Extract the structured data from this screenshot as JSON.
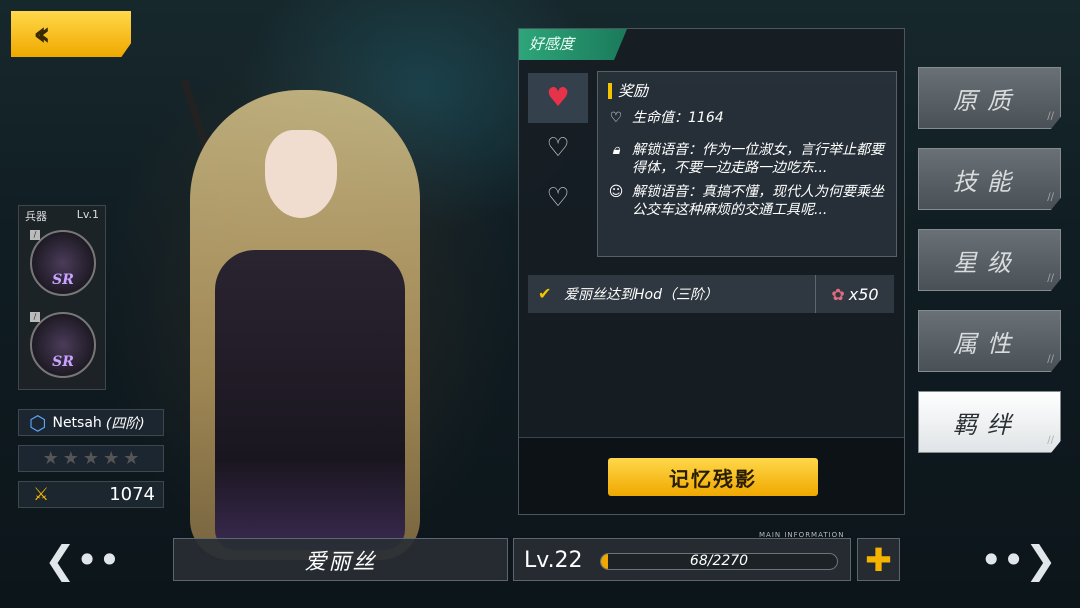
{
  "back": {
    "icon": "back-chevron-icon"
  },
  "weapon": {
    "label": "兵器",
    "level": "Lv.1",
    "slot1_rank": "SR",
    "slot2_rank": "SR"
  },
  "rank": {
    "name": "Netsah",
    "tier": "(四阶)"
  },
  "stars": {
    "filled": 0,
    "total": 5
  },
  "power": {
    "value": "1074"
  },
  "affection": {
    "tab_label": "好感度",
    "reward": {
      "title": "奖励",
      "hp_label": "生命值：1164",
      "voice1": "解锁语音：作为一位淑女，言行举止都要得体，不要一边走路一边吃东...",
      "voice2": "解锁语音：真搞不懂，现代人为何要乘坐公交车这种麻烦的交通工具呢..."
    },
    "task": {
      "text": "爱丽丝达到Hod（三阶）",
      "cost": "x50",
      "completed": true
    },
    "memory_button": "记忆残影"
  },
  "menu": [
    {
      "label": "原质",
      "active": false
    },
    {
      "label": "技能",
      "active": false
    },
    {
      "label": "星级",
      "active": false
    },
    {
      "label": "属性",
      "active": false
    },
    {
      "label": "羁绊",
      "active": true
    }
  ],
  "character": {
    "name": "爱丽丝",
    "level": "Lv.22",
    "exp_text": "68/2270",
    "exp_fraction": 0.03,
    "main_info": "MAIN INFORMATION"
  },
  "colors": {
    "accent": "#f5b400",
    "tab": "#2ea57a",
    "heart_active": "#e8324a"
  }
}
